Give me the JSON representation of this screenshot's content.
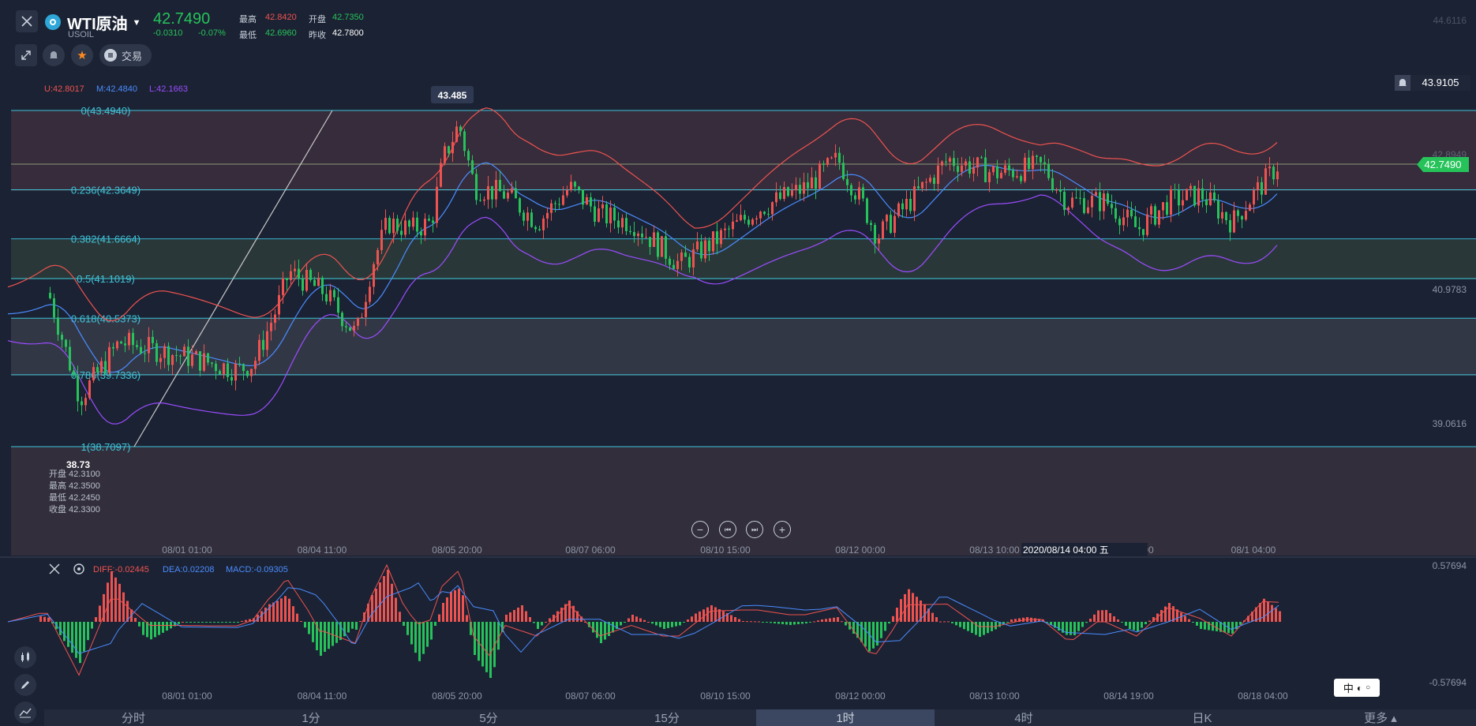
{
  "symbol": {
    "name": "WTI原油",
    "code": "USOIL",
    "price": "42.7490",
    "change": "-0.0310",
    "change_pct": "-0.07%"
  },
  "quote": {
    "high_label": "最高",
    "high": "42.8420",
    "open_label": "开盘",
    "open": "42.7350",
    "low_label": "最低",
    "low": "42.6960",
    "prev_label": "昨收",
    "prev": "42.7800"
  },
  "toolbar": {
    "trade_label": "交易"
  },
  "bollinger": {
    "u": "U:42.8017",
    "m": "M:42.4840",
    "l": "L:42.1663"
  },
  "price_axis": {
    "top": "44.6116",
    "upper": "42.8949",
    "mid": "40.9783",
    "lower": "39.0616",
    "alert_price": "43.9105",
    "current_price": "42.7490"
  },
  "fib_levels": [
    {
      "label": "0(43.4940)",
      "y": 43.494
    },
    {
      "label": "0.236(42.3649)",
      "y": 42.3649
    },
    {
      "label": "0.382(41.6664)",
      "y": 41.6664
    },
    {
      "label": "0.5(41.1019)",
      "y": 41.1019
    },
    {
      "label": "0.618(40.5373)",
      "y": 40.5373
    },
    {
      "label": "0.786(39.7336)",
      "y": 39.7336
    },
    {
      "label": "1(38.7097)",
      "y": 38.7097
    }
  ],
  "annotations": {
    "high_marker": "43.485",
    "low_marker": "38.73"
  },
  "ohlc_tooltip": {
    "open": "开盘 42.3100",
    "high": "最高 42.3500",
    "low": "最低 42.2450",
    "close": "收盘 42.3300"
  },
  "time_axis": [
    "08/01 01:00",
    "08/04 11:00",
    "08/05 20:00",
    "08/07 06:00",
    "08/10 15:00",
    "08/12 00:00",
    "08/13 10:00",
    "08/14 19:00"
  ],
  "crosshair_time": "2020/08/14 04:00 五",
  "crosshair_tail": "08/1 04:00",
  "macd": {
    "diff": "DIFF:-0.02445",
    "dea": "DEA:0.02208",
    "macd": "MACD:-0.09305",
    "axis_top": "0.57694",
    "axis_bottom": "-0.57694"
  },
  "macd_time_axis": [
    "08/01 01:00",
    "08/04 11:00",
    "08/05 20:00",
    "08/07 06:00",
    "08/10 15:00",
    "08/12 00:00",
    "08/13 10:00",
    "08/14 19:00",
    "08/18 04:00"
  ],
  "ime": {
    "text": "中"
  },
  "tabs": [
    "分时",
    "1分",
    "5分",
    "15分",
    "1时",
    "4时",
    "日K",
    "更多"
  ],
  "active_tab": "1时",
  "colors": {
    "bg": "#1b2233",
    "up": "#ef5350",
    "down": "#26c35a",
    "fib": "#3fc4d8",
    "upper_band": "#ef5350",
    "mid_band": "#4a8cff",
    "lower_band": "#9b4dff"
  }
}
